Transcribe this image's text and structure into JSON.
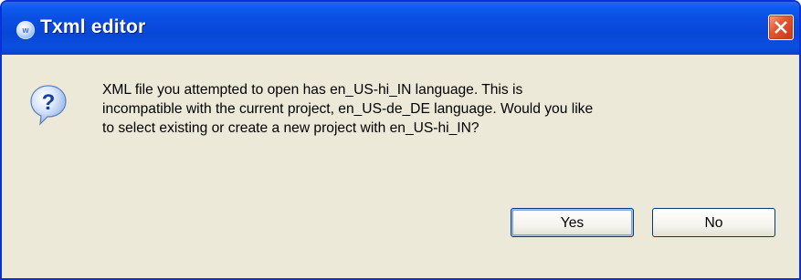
{
  "window": {
    "title": "Txml editor",
    "app_icon_glyph": "w"
  },
  "dialog": {
    "message_lines": [
      "XML file you attempted to open has en_US-hi_IN language.  This is",
      "incompatible with the current project, en_US-de_DE language. Would you like",
      "to select existing or create a new project with en_US-hi_IN?"
    ],
    "icon": "question-icon"
  },
  "buttons": {
    "yes_label": "Yes",
    "no_label": "No"
  },
  "colors": {
    "titlebar": "#0a4fe3",
    "window_border": "#0831d9",
    "dialog_background": "#ece9d8",
    "close_button": "#e5582e",
    "button_border": "#003c74"
  }
}
